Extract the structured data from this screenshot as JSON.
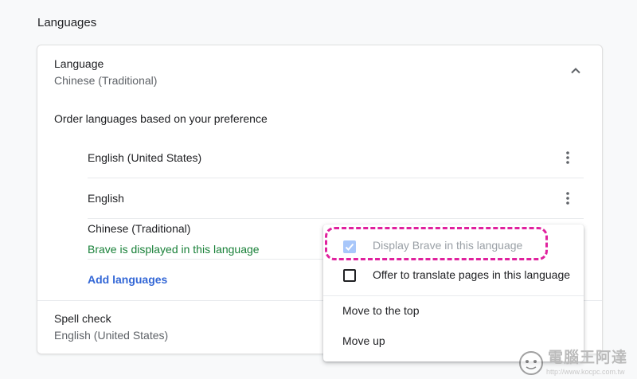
{
  "section": {
    "title": "Languages"
  },
  "language": {
    "label": "Language",
    "value": "Chinese (Traditional)"
  },
  "order_text": "Order languages based on your preference",
  "languages": [
    {
      "name": "English (United States)"
    },
    {
      "name": "English"
    },
    {
      "name": "Chinese (Traditional)",
      "status": "Brave is displayed in this language"
    }
  ],
  "add_languages": "Add languages",
  "spell_check": {
    "label": "Spell check",
    "value": "English (United States)"
  },
  "menu": {
    "display_brave": {
      "label": "Display Brave in this language",
      "checked": true,
      "disabled": true
    },
    "offer_translate": {
      "label": "Offer to translate pages in this language",
      "checked": false
    },
    "move_top": "Move to the top",
    "move_up": "Move up"
  },
  "watermark": {
    "title": "電腦王阿達",
    "url": "http://www.kocpc.com.tw"
  },
  "colors": {
    "accent": "#3367d6",
    "status_green": "#188038",
    "highlight": "#e0219e",
    "checkbox_disabled": "#a8c7fa"
  }
}
